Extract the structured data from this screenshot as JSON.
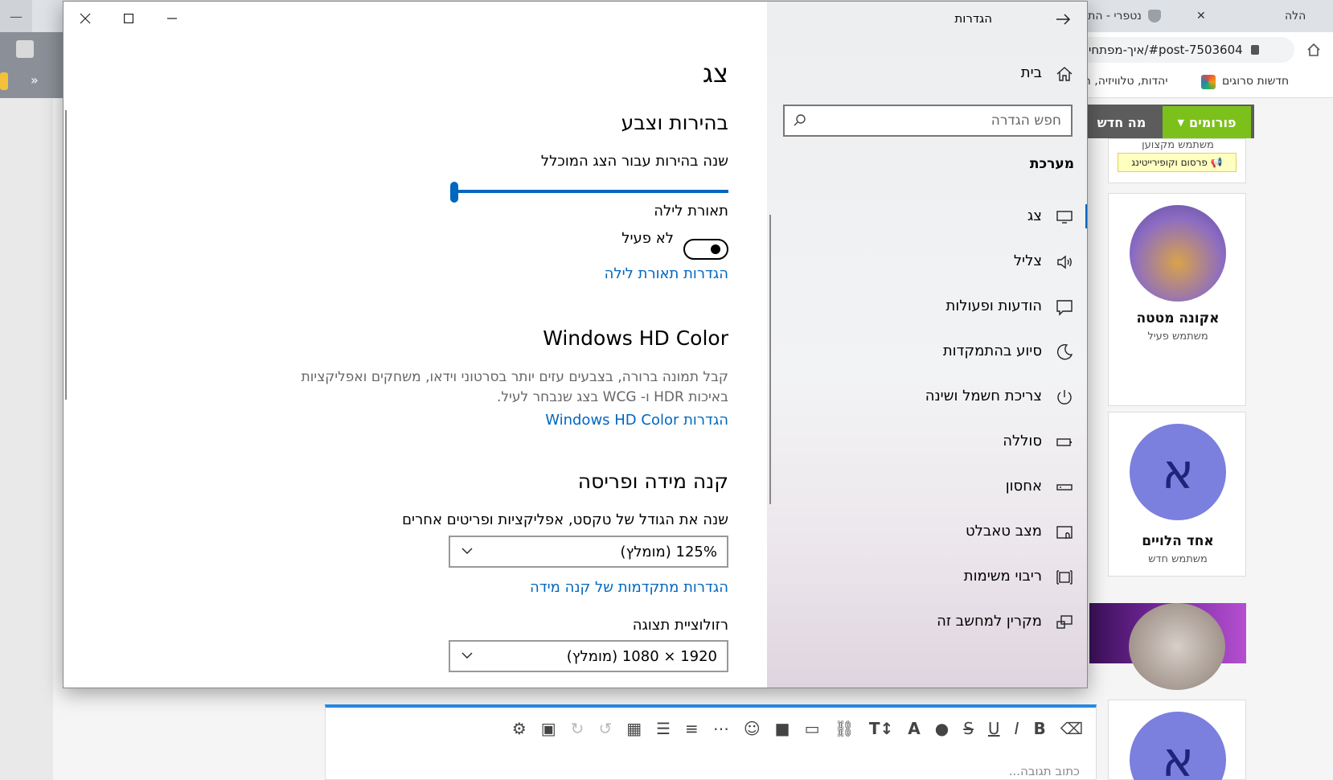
{
  "browser": {
    "tab_left_label": "—",
    "tab1_label": "נטפרי - התי",
    "tab2_label": "הלה",
    "tab_close_glyph": "✕",
    "url": "איך-מפתחי/#post-7503604",
    "bookmarks": [
      "חדשות סרוגים",
      "יהדות, טלוויזיה, חד"
    ],
    "bookmarks_more": "»"
  },
  "forum": {
    "forums_label": "פורומים",
    "whatsnew_label": "מה חדש",
    "expert_user": "משתמש מקצוען",
    "promo_label": "פרסום וקופירייטינג",
    "user1_name": "אקונה מטטה",
    "user1_role": "משתמש פעיל",
    "user2_name": "אחד הלויים",
    "user2_role": "משתמש חדש",
    "avatar_letter": "א",
    "reply_placeholder": "כתוב תגובה..."
  },
  "settings": {
    "app_title": "הגדרות",
    "home_label": "בית",
    "search_placeholder": "חפש הגדרה",
    "section_label": "מערכת",
    "nav_items": [
      {
        "label": "צג",
        "active": true
      },
      {
        "label": "צליל",
        "active": false
      },
      {
        "label": "הודעות ופעולות",
        "active": false
      },
      {
        "label": "סיוע בהתמקדות",
        "active": false
      },
      {
        "label": "צריכת חשמל ושינה",
        "active": false
      },
      {
        "label": "סוללה",
        "active": false
      },
      {
        "label": "אחסון",
        "active": false
      },
      {
        "label": "מצב טאבלט",
        "active": false
      },
      {
        "label": "ריבוי משימות",
        "active": false
      },
      {
        "label": "מקרין למחשב זה",
        "active": false
      }
    ],
    "page_title": "צג",
    "brightness_heading": "בהירות וצבע",
    "brightness_label": "שנה בהירות עבור הצג המוכלל",
    "brightness_value": 0,
    "night_light_label": "תאורת לילה",
    "night_light_state": "לא פעיל",
    "night_light_settings_link": "הגדרות תאורת לילה",
    "hd_color_heading": "Windows HD Color",
    "hd_color_desc_line1": "קבל תמונה ברורה, בצבעים עזים יותר בסרטוני וידאו, משחקים ואפליקציות",
    "hd_color_desc_line2": "באיכות HDR ו- WCG בצג שנבחר לעיל.",
    "hd_color_link": "הגדרות Windows HD Color",
    "scale_heading": "קנה מידה ופריסה",
    "scale_label": "שנה את הגודל של טקסט, אפליקציות ופריטים אחרים",
    "scale_value": "125% (מומלץ)",
    "scale_advanced_link": "הגדרות מתקדמות של קנה מידה",
    "resolution_label": "רזולוציית תצוגה",
    "resolution_value": "1920 × 1080 (מומלץ)"
  },
  "colors": {
    "accent": "#0067c0",
    "forum_green": "#7cc11b",
    "avatar_purple": "#7b7fdd"
  }
}
